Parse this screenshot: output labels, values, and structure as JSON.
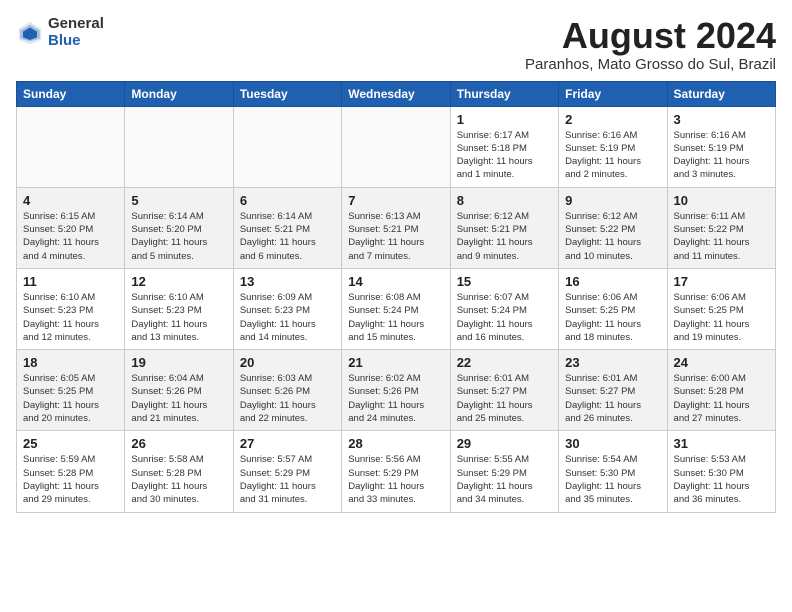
{
  "logo": {
    "general": "General",
    "blue": "Blue"
  },
  "title": "August 2024",
  "subtitle": "Paranhos, Mato Grosso do Sul, Brazil",
  "headers": [
    "Sunday",
    "Monday",
    "Tuesday",
    "Wednesday",
    "Thursday",
    "Friday",
    "Saturday"
  ],
  "weeks": [
    [
      {
        "day": "",
        "info": ""
      },
      {
        "day": "",
        "info": ""
      },
      {
        "day": "",
        "info": ""
      },
      {
        "day": "",
        "info": ""
      },
      {
        "day": "1",
        "info": "Sunrise: 6:17 AM\nSunset: 5:18 PM\nDaylight: 11 hours\nand 1 minute."
      },
      {
        "day": "2",
        "info": "Sunrise: 6:16 AM\nSunset: 5:19 PM\nDaylight: 11 hours\nand 2 minutes."
      },
      {
        "day": "3",
        "info": "Sunrise: 6:16 AM\nSunset: 5:19 PM\nDaylight: 11 hours\nand 3 minutes."
      }
    ],
    [
      {
        "day": "4",
        "info": "Sunrise: 6:15 AM\nSunset: 5:20 PM\nDaylight: 11 hours\nand 4 minutes."
      },
      {
        "day": "5",
        "info": "Sunrise: 6:14 AM\nSunset: 5:20 PM\nDaylight: 11 hours\nand 5 minutes."
      },
      {
        "day": "6",
        "info": "Sunrise: 6:14 AM\nSunset: 5:21 PM\nDaylight: 11 hours\nand 6 minutes."
      },
      {
        "day": "7",
        "info": "Sunrise: 6:13 AM\nSunset: 5:21 PM\nDaylight: 11 hours\nand 7 minutes."
      },
      {
        "day": "8",
        "info": "Sunrise: 6:12 AM\nSunset: 5:21 PM\nDaylight: 11 hours\nand 9 minutes."
      },
      {
        "day": "9",
        "info": "Sunrise: 6:12 AM\nSunset: 5:22 PM\nDaylight: 11 hours\nand 10 minutes."
      },
      {
        "day": "10",
        "info": "Sunrise: 6:11 AM\nSunset: 5:22 PM\nDaylight: 11 hours\nand 11 minutes."
      }
    ],
    [
      {
        "day": "11",
        "info": "Sunrise: 6:10 AM\nSunset: 5:23 PM\nDaylight: 11 hours\nand 12 minutes."
      },
      {
        "day": "12",
        "info": "Sunrise: 6:10 AM\nSunset: 5:23 PM\nDaylight: 11 hours\nand 13 minutes."
      },
      {
        "day": "13",
        "info": "Sunrise: 6:09 AM\nSunset: 5:23 PM\nDaylight: 11 hours\nand 14 minutes."
      },
      {
        "day": "14",
        "info": "Sunrise: 6:08 AM\nSunset: 5:24 PM\nDaylight: 11 hours\nand 15 minutes."
      },
      {
        "day": "15",
        "info": "Sunrise: 6:07 AM\nSunset: 5:24 PM\nDaylight: 11 hours\nand 16 minutes."
      },
      {
        "day": "16",
        "info": "Sunrise: 6:06 AM\nSunset: 5:25 PM\nDaylight: 11 hours\nand 18 minutes."
      },
      {
        "day": "17",
        "info": "Sunrise: 6:06 AM\nSunset: 5:25 PM\nDaylight: 11 hours\nand 19 minutes."
      }
    ],
    [
      {
        "day": "18",
        "info": "Sunrise: 6:05 AM\nSunset: 5:25 PM\nDaylight: 11 hours\nand 20 minutes."
      },
      {
        "day": "19",
        "info": "Sunrise: 6:04 AM\nSunset: 5:26 PM\nDaylight: 11 hours\nand 21 minutes."
      },
      {
        "day": "20",
        "info": "Sunrise: 6:03 AM\nSunset: 5:26 PM\nDaylight: 11 hours\nand 22 minutes."
      },
      {
        "day": "21",
        "info": "Sunrise: 6:02 AM\nSunset: 5:26 PM\nDaylight: 11 hours\nand 24 minutes."
      },
      {
        "day": "22",
        "info": "Sunrise: 6:01 AM\nSunset: 5:27 PM\nDaylight: 11 hours\nand 25 minutes."
      },
      {
        "day": "23",
        "info": "Sunrise: 6:01 AM\nSunset: 5:27 PM\nDaylight: 11 hours\nand 26 minutes."
      },
      {
        "day": "24",
        "info": "Sunrise: 6:00 AM\nSunset: 5:28 PM\nDaylight: 11 hours\nand 27 minutes."
      }
    ],
    [
      {
        "day": "25",
        "info": "Sunrise: 5:59 AM\nSunset: 5:28 PM\nDaylight: 11 hours\nand 29 minutes."
      },
      {
        "day": "26",
        "info": "Sunrise: 5:58 AM\nSunset: 5:28 PM\nDaylight: 11 hours\nand 30 minutes."
      },
      {
        "day": "27",
        "info": "Sunrise: 5:57 AM\nSunset: 5:29 PM\nDaylight: 11 hours\nand 31 minutes."
      },
      {
        "day": "28",
        "info": "Sunrise: 5:56 AM\nSunset: 5:29 PM\nDaylight: 11 hours\nand 33 minutes."
      },
      {
        "day": "29",
        "info": "Sunrise: 5:55 AM\nSunset: 5:29 PM\nDaylight: 11 hours\nand 34 minutes."
      },
      {
        "day": "30",
        "info": "Sunrise: 5:54 AM\nSunset: 5:30 PM\nDaylight: 11 hours\nand 35 minutes."
      },
      {
        "day": "31",
        "info": "Sunrise: 5:53 AM\nSunset: 5:30 PM\nDaylight: 11 hours\nand 36 minutes."
      }
    ]
  ]
}
